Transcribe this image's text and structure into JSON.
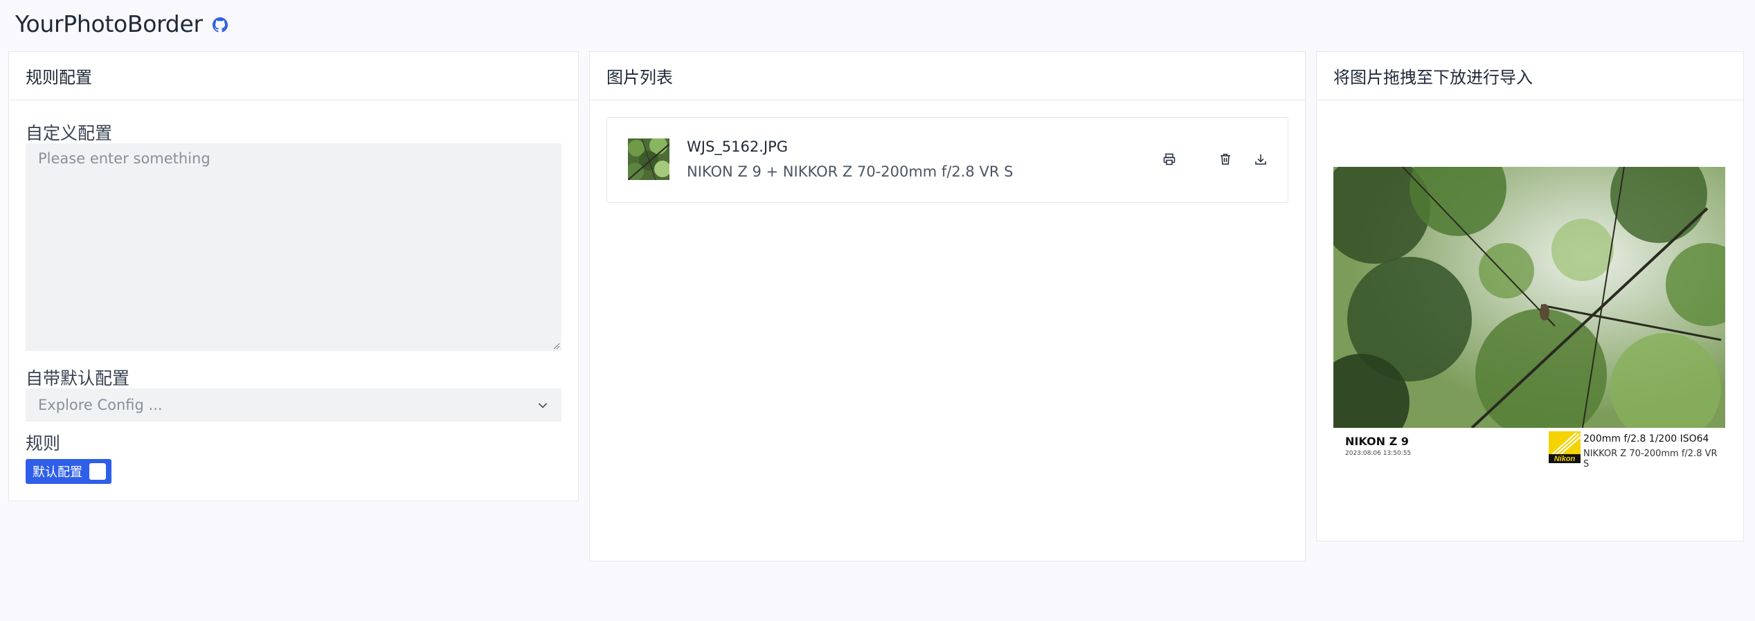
{
  "app": {
    "title": "YourPhotoBorder",
    "github_icon": "github-icon"
  },
  "rules_panel": {
    "title": "规则配置",
    "custom_config_label": "自定义配置",
    "custom_config_placeholder": "Please enter something",
    "custom_config_value": "",
    "default_config_label": "自带默认配置",
    "default_config_placeholder": "Explore Config ...",
    "rules_label": "规则",
    "rule_tag_label": "默认配置"
  },
  "list_panel": {
    "title": "图片列表",
    "items": [
      {
        "filename": "WJS_5162.JPG",
        "meta": "NIKON Z 9 + NIKKOR Z 70-200mm f/2.8 VR S",
        "actions": [
          "printer-icon",
          "trash-icon",
          "download-icon"
        ]
      }
    ]
  },
  "import_panel": {
    "title": "将图片拖拽至下放进行导入",
    "preview": {
      "camera_model": "NIKON Z 9",
      "capture_time": "2023:08:06 13:50:55",
      "exposure": "200mm f/2.8 1/200 ISO64",
      "lens": "NIKKOR Z 70-200mm f/2.8 VR S",
      "logo_text": "Nikon",
      "logo_color": "#f5d300"
    }
  },
  "colors": {
    "accent": "#2f5fe8",
    "background": "#f8f8fd",
    "input_bg": "#f1f2f4"
  }
}
